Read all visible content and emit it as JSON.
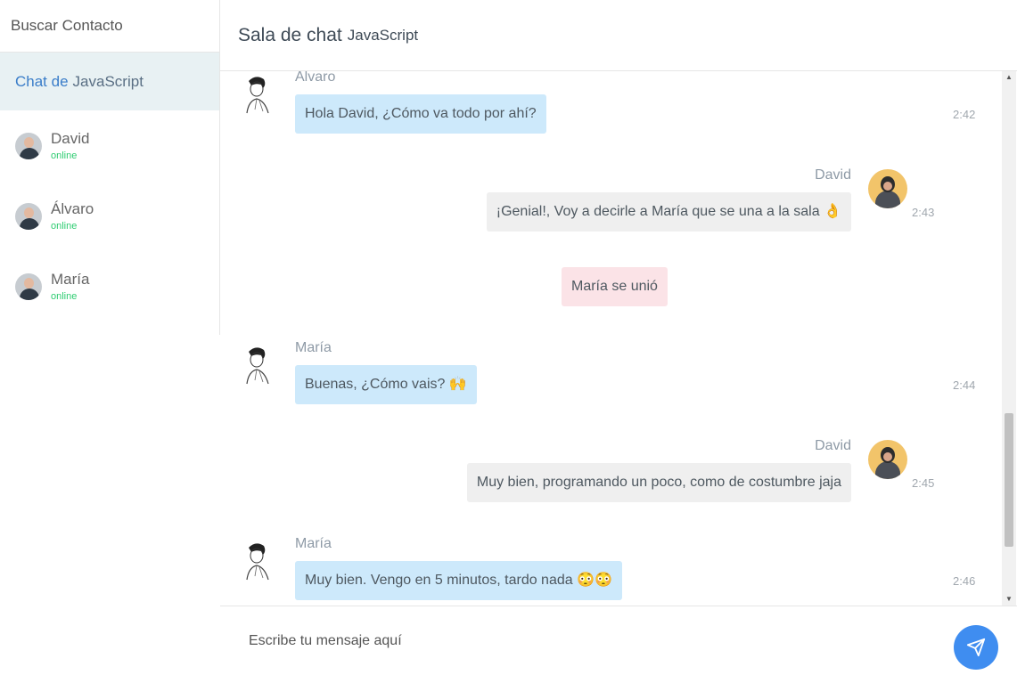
{
  "sidebar": {
    "search_placeholder": "Buscar Contacto",
    "room": {
      "label": "Chat de",
      "name": "JavaScript"
    },
    "contacts": [
      {
        "name": "David",
        "status": "online"
      },
      {
        "name": "Álvaro",
        "status": "online"
      },
      {
        "name": "María",
        "status": "online"
      }
    ]
  },
  "header": {
    "title": "Sala de chat",
    "room": "JavaScript"
  },
  "messages": [
    {
      "sender": "Álvaro",
      "text": "Hola David, ¿Cómo va todo por ahí?",
      "time": "2:42",
      "side": "left"
    },
    {
      "sender": "David",
      "text": "¡Genial!, Voy a decirle a María que se una a la sala 👌",
      "time": "2:43",
      "side": "right"
    },
    {
      "system": "María se unió"
    },
    {
      "sender": "María",
      "text": "Buenas, ¿Cómo vais? 🙌",
      "time": "2:44",
      "side": "left"
    },
    {
      "sender": "David",
      "text": "Muy bien, programando un poco, como de costumbre jaja",
      "time": "2:45",
      "side": "right"
    },
    {
      "sender": "María",
      "text": "Muy bien. Vengo en 5 minutos, tardo nada 😳😳",
      "time": "2:46",
      "side": "left"
    }
  ],
  "composer": {
    "placeholder": "Escribe tu mensaje aquí"
  },
  "icons": {
    "send": "paper-plane-icon",
    "scroll_up": "scroll-up-arrow-icon",
    "scroll_down": "scroll-down-arrow-icon"
  },
  "colors": {
    "accent": "#3f8df0",
    "online": "#2ecc71",
    "bubble_self": "#cde9fb",
    "bubble_other": "#efefef",
    "bubble_system": "#fbe3e7"
  }
}
